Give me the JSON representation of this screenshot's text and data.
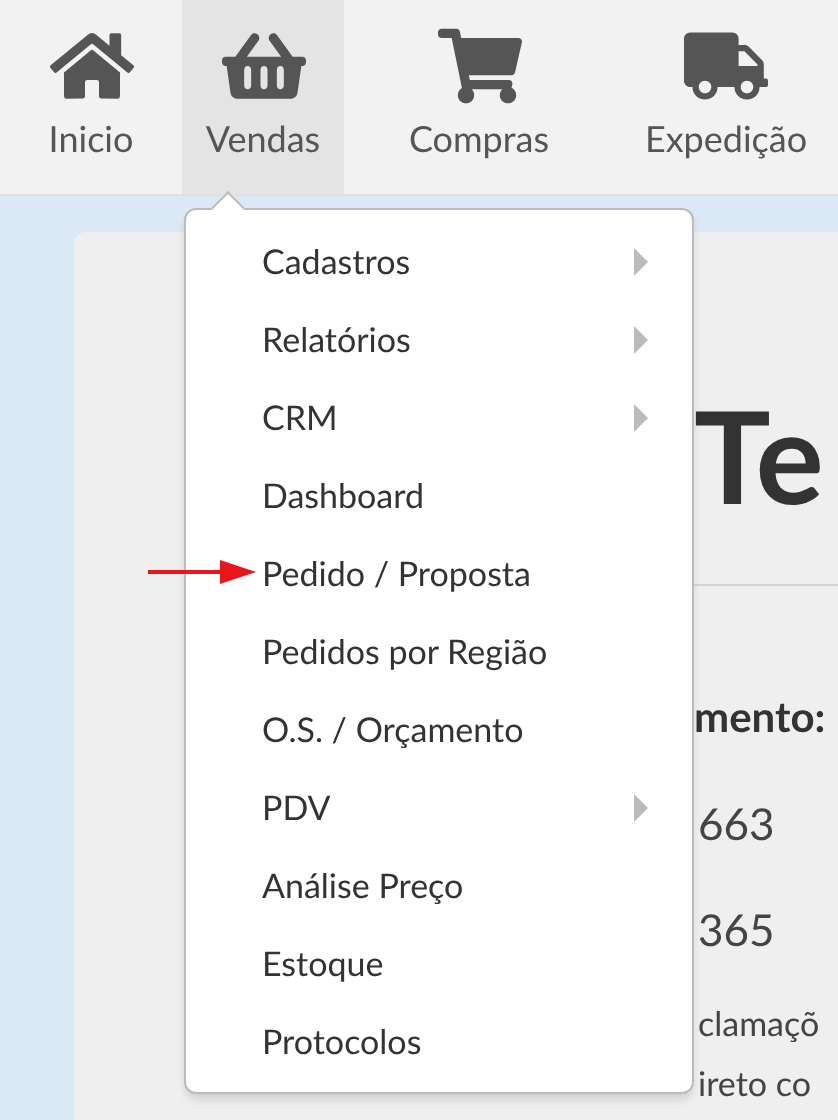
{
  "nav": {
    "items": [
      {
        "label": "Inicio",
        "kind": "home",
        "selected": false
      },
      {
        "label": "Vendas",
        "kind": "basket",
        "selected": true
      },
      {
        "label": "Compras",
        "kind": "cart",
        "selected": false
      },
      {
        "label": "Expedição",
        "kind": "truck",
        "selected": false
      }
    ]
  },
  "card": {
    "heading": "Te",
    "subheading": "mento:",
    "lines": [
      "663",
      "365"
    ],
    "paragraph": [
      "clamaçõ",
      "ireto co"
    ]
  },
  "menu": {
    "items": [
      {
        "label": "Cadastros",
        "submenu": true,
        "pointed": false
      },
      {
        "label": "Relatórios",
        "submenu": true,
        "pointed": false
      },
      {
        "label": "CRM",
        "submenu": true,
        "pointed": false
      },
      {
        "label": "Dashboard",
        "submenu": false,
        "pointed": false
      },
      {
        "label": "Pedido / Proposta",
        "submenu": false,
        "pointed": true
      },
      {
        "label": "Pedidos por Região",
        "submenu": false,
        "pointed": false
      },
      {
        "label": "O.S. / Orçamento",
        "submenu": false,
        "pointed": false
      },
      {
        "label": "PDV",
        "submenu": true,
        "pointed": false
      },
      {
        "label": "Análise Preço",
        "submenu": false,
        "pointed": false
      },
      {
        "label": "Estoque",
        "submenu": false,
        "pointed": false
      },
      {
        "label": "Protocolos",
        "submenu": false,
        "pointed": false
      }
    ]
  }
}
